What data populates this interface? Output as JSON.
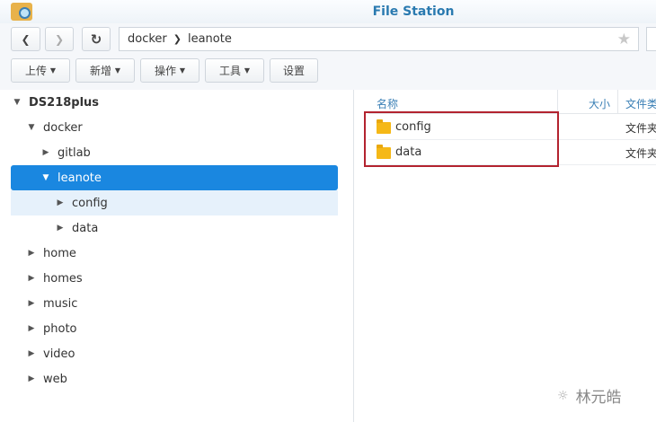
{
  "window": {
    "title": "File Station"
  },
  "nav": {
    "path": [
      "docker",
      "leanote"
    ]
  },
  "toolbar": {
    "upload": "上传",
    "create": "新增",
    "action": "操作",
    "tools": "工具",
    "settings": "设置"
  },
  "tree": [
    {
      "label": "DS218plus",
      "level": 0,
      "expanded": true,
      "bold": true
    },
    {
      "label": "docker",
      "level": 1,
      "expanded": true
    },
    {
      "label": "gitlab",
      "level": 2,
      "expanded": false
    },
    {
      "label": "leanote",
      "level": 2,
      "expanded": true,
      "selected": true
    },
    {
      "label": "config",
      "level": 3,
      "expanded": false,
      "highlighted": true
    },
    {
      "label": "data",
      "level": 3,
      "expanded": false
    },
    {
      "label": "home",
      "level": 1,
      "expanded": false
    },
    {
      "label": "homes",
      "level": 1,
      "expanded": false
    },
    {
      "label": "music",
      "level": 1,
      "expanded": false
    },
    {
      "label": "photo",
      "level": 1,
      "expanded": false
    },
    {
      "label": "video",
      "level": 1,
      "expanded": false
    },
    {
      "label": "web",
      "level": 1,
      "expanded": false
    }
  ],
  "list": {
    "columns": {
      "name": "名称",
      "size": "大小",
      "type": "文件类型"
    },
    "rows": [
      {
        "name": "config",
        "type": "文件夹"
      },
      {
        "name": "data",
        "type": "文件夹"
      }
    ]
  },
  "watermark": "林元皓"
}
